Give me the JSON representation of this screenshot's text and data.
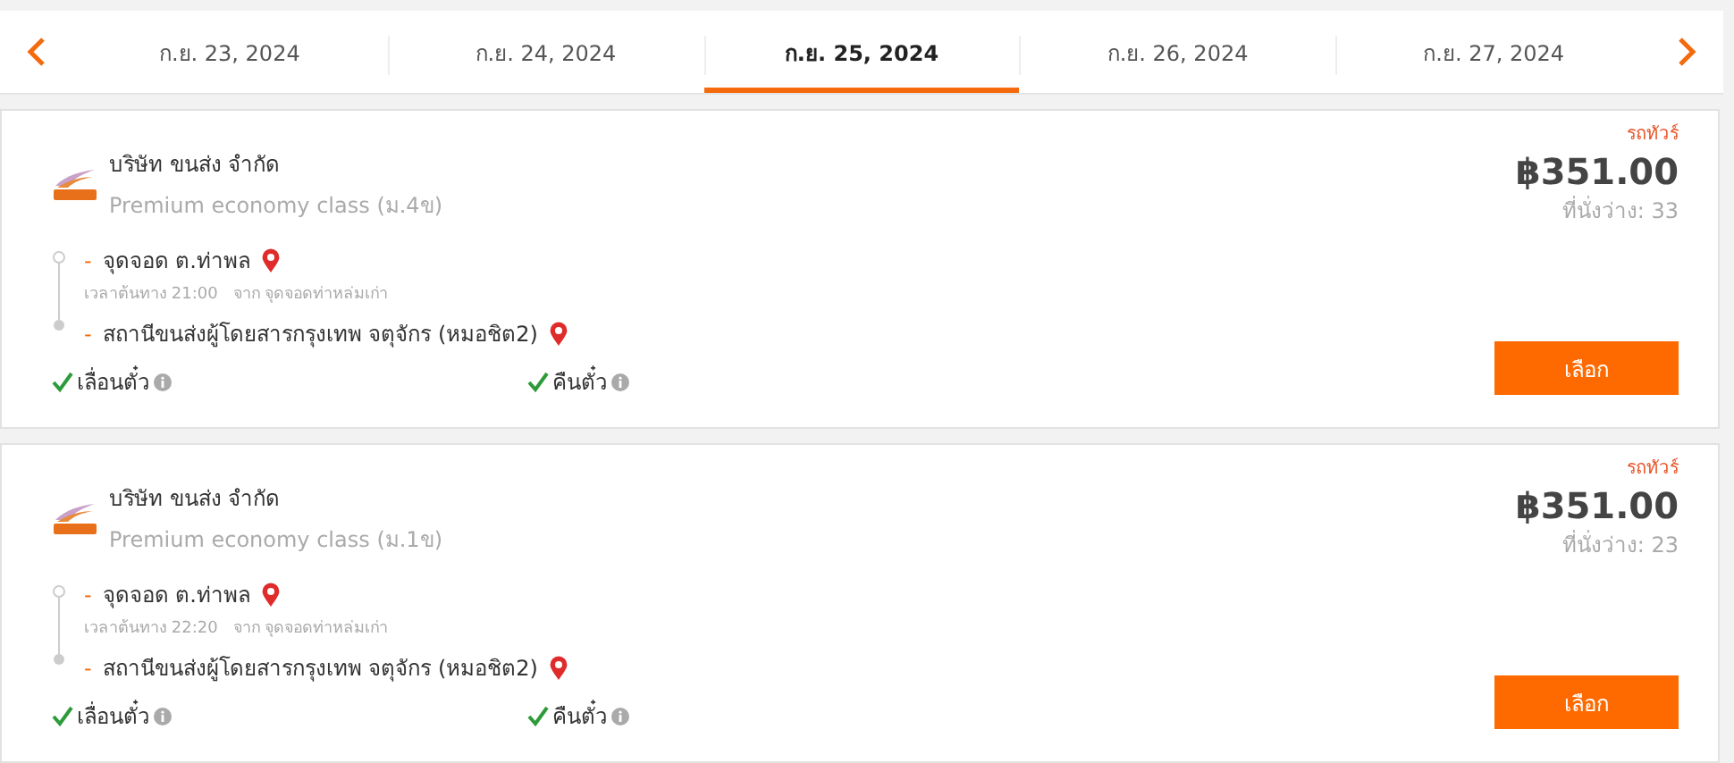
{
  "dates": [
    {
      "label": "ก.ย. 23, 2024",
      "selected": false
    },
    {
      "label": "ก.ย. 24, 2024",
      "selected": false
    },
    {
      "label": "ก.ย. 25, 2024",
      "selected": true
    },
    {
      "label": "ก.ย. 26, 2024",
      "selected": false
    },
    {
      "label": "ก.ย. 27, 2024",
      "selected": false
    }
  ],
  "trips": [
    {
      "operator": "บริษัท ขนส่ง จำกัด",
      "class": "Premium economy class (ม.4ข)",
      "tag": "รถทัวร์",
      "price": "฿351.00",
      "seats": "ที่นั่งว่าง: 33",
      "stops": [
        {
          "marker": "-",
          "name": "จุดจอด ต.ท่าพล",
          "note": "เวลาต้นทาง 21:00   จาก จุดจอดท่าหล่มเก่า"
        },
        {
          "marker": "-",
          "name": "สถานีขนส่งผู้โดยสารกรุงเทพ จตุจักร (หมอชิต2)"
        }
      ],
      "features": [
        {
          "label": "เลื่อนตั๋ว",
          "available": true
        },
        {
          "label": "คืนตั๋ว",
          "available": true
        }
      ],
      "button": "เลือก"
    },
    {
      "operator": "บริษัท ขนส่ง จำกัด",
      "class": "Premium economy class (ม.1ข)",
      "tag": "รถทัวร์",
      "price": "฿351.00",
      "seats": "ที่นั่งว่าง: 23",
      "stops": [
        {
          "marker": "-",
          "name": "จุดจอด ต.ท่าพล",
          "note": "เวลาต้นทาง 22:20   จาก จุดจอดท่าหล่มเก่า"
        },
        {
          "marker": "-",
          "name": "สถานีขนส่งผู้โดยสารกรุงเทพ จตุจักร (หมอชิต2)"
        }
      ],
      "features": [
        {
          "label": "เลื่อนตั๋ว",
          "available": true
        },
        {
          "label": "คืนตั๋ว",
          "available": true
        }
      ],
      "button": "เลือก"
    }
  ]
}
